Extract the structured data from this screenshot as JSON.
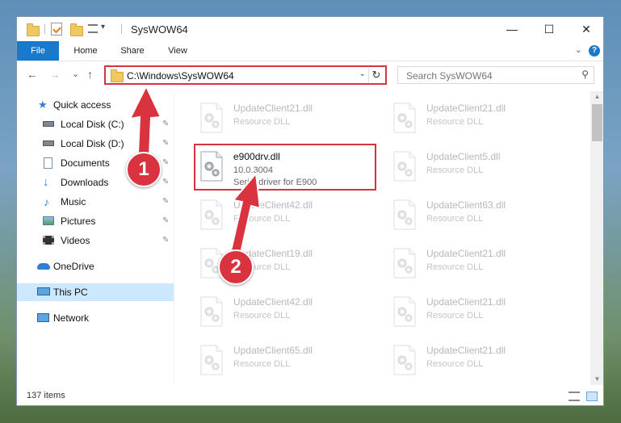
{
  "window": {
    "title": "SysWOW64",
    "controls": {
      "minimize": "—",
      "maximize": "☐",
      "close": "✕"
    }
  },
  "ribbon": {
    "tabs": [
      "File",
      "Home",
      "Share",
      "View"
    ],
    "help": "?",
    "collapse": "⌄"
  },
  "navigation": {
    "back": "←",
    "forward": "→",
    "recent": "⌄",
    "up": "↑",
    "address": "C:\\Windows\\SysWOW64",
    "address_dropdown": "⌄",
    "refresh": "↻",
    "search_placeholder": "Search SysWOW64"
  },
  "nav_pane": {
    "items": [
      {
        "label": "Quick access",
        "icon": "star-icon",
        "pinned": false
      },
      {
        "label": "Local Disk (C:)",
        "icon": "drive-icon",
        "pinned": true
      },
      {
        "label": "Local Disk (D:)",
        "icon": "drive-icon",
        "pinned": true
      },
      {
        "label": "Documents",
        "icon": "documents-icon",
        "pinned": true
      },
      {
        "label": "Downloads",
        "icon": "download-icon",
        "pinned": true
      },
      {
        "label": "Music",
        "icon": "music-icon",
        "pinned": true
      },
      {
        "label": "Pictures",
        "icon": "pictures-icon",
        "pinned": true
      },
      {
        "label": "Videos",
        "icon": "videos-icon",
        "pinned": true
      },
      {
        "label": "OneDrive",
        "icon": "cloud-icon",
        "pinned": false
      },
      {
        "label": "This PC",
        "icon": "computer-icon",
        "pinned": false
      },
      {
        "label": "Network",
        "icon": "network-icon",
        "pinned": false
      }
    ],
    "pin_glyph": "📌"
  },
  "files": {
    "left": [
      {
        "name": "UpdateClient21.dll",
        "desc": "Resource DLL"
      },
      {
        "name": "e900drv.dll",
        "desc": "10.0.3004",
        "desc2": "Serial driver for E900"
      },
      {
        "name": "UpdateClient42.dll",
        "desc": "Resource DLL"
      },
      {
        "name": "UpdateClient19.dll",
        "desc": "Resource DLL"
      },
      {
        "name": "UpdateClient42.dll",
        "desc": "Resource DLL"
      },
      {
        "name": "UpdateClient65.dll",
        "desc": "Resource DLL"
      }
    ],
    "right": [
      {
        "name": "UpdateClient21.dll",
        "desc": "Resource DLL"
      },
      {
        "name": "UpdateClient5.dll",
        "desc": "Resource DLL"
      },
      {
        "name": "UpdateClient63.dll",
        "desc": "Resource DLL"
      },
      {
        "name": "UpdateClient21.dll",
        "desc": "Resource DLL"
      },
      {
        "name": "UpdateClient21.dll",
        "desc": "Resource DLL"
      },
      {
        "name": "UpdateClient21.dll",
        "desc": "Resource DLL"
      }
    ]
  },
  "status": {
    "count": "137 items"
  },
  "annotations": {
    "step1": "1",
    "step2": "2",
    "color": "#d9333f"
  },
  "colors": {
    "accent": "#1979ca",
    "highlight": "#d9333f",
    "selected": "#cce8ff"
  }
}
